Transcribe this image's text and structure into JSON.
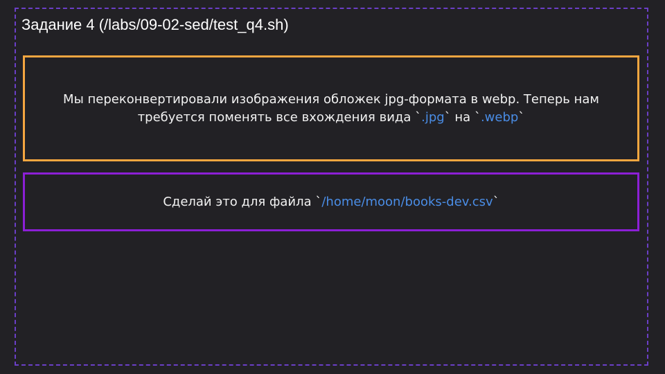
{
  "title": "Задание 4 (/labs/09-02-sed/test_q4.sh)",
  "task": {
    "text_before": "Мы переконвертировали изображения обложек jpg-формата в webp. Теперь нам требуется поменять все вхождения вида ",
    "tick": "`",
    "code_from": ".jpg",
    "text_middle": " на ",
    "code_to": ".webp"
  },
  "file": {
    "text_before": "Сделай это для файла ",
    "tick": "`",
    "path": "/home/moon/books-dev.csv"
  },
  "colors": {
    "background": "#222125",
    "frame_dashed": "#6b3fc7",
    "task_border": "#f5a640",
    "file_border": "#8c1fd6",
    "code_text": "#4a8de6"
  }
}
